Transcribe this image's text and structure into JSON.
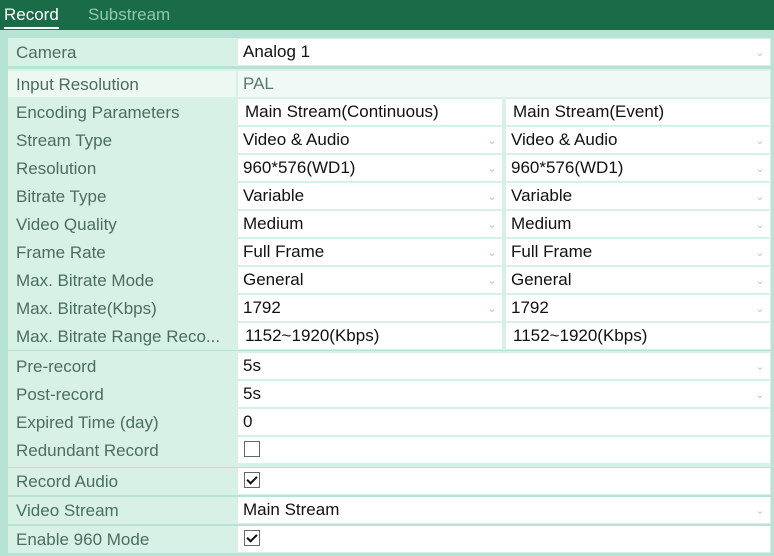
{
  "tabs": [
    {
      "label": "Record",
      "active": true
    },
    {
      "label": "Substream",
      "active": false
    }
  ],
  "camera": {
    "label": "Camera",
    "value": "Analog 1"
  },
  "input_resolution": {
    "label": "Input Resolution",
    "value": "PAL"
  },
  "encoding": {
    "label": "Encoding Parameters",
    "col_main": "Main Stream(Continuous)",
    "col_event": "Main Stream(Event)",
    "rows": [
      {
        "label": "Stream Type",
        "main": "Video & Audio",
        "event": "Video & Audio"
      },
      {
        "label": "Resolution",
        "main": "960*576(WD1)",
        "event": "960*576(WD1)"
      },
      {
        "label": "Bitrate Type",
        "main": "Variable",
        "event": "Variable"
      },
      {
        "label": "Video Quality",
        "main": "Medium",
        "event": "Medium"
      },
      {
        "label": "Frame Rate",
        "main": "Full Frame",
        "event": "Full Frame"
      },
      {
        "label": "Max. Bitrate Mode",
        "main": "General",
        "event": "General"
      },
      {
        "label": "Max. Bitrate(Kbps)",
        "main": "1792",
        "event": "1792"
      }
    ],
    "range_label": "Max. Bitrate Range Reco...",
    "range_main": "1152~1920(Kbps)",
    "range_event": "1152~1920(Kbps)"
  },
  "pre_record": {
    "label": "Pre-record",
    "value": "5s"
  },
  "post_record": {
    "label": "Post-record",
    "value": "5s"
  },
  "expired_time": {
    "label": "Expired Time (day)",
    "value": "0"
  },
  "redundant_record": {
    "label": "Redundant Record",
    "checked": false
  },
  "record_audio": {
    "label": "Record Audio",
    "checked": true
  },
  "video_stream": {
    "label": "Video Stream",
    "value": "Main Stream"
  },
  "enable_960": {
    "label": "Enable 960 Mode",
    "checked": true
  },
  "icons": {
    "dropdown": "chevron-down-icon",
    "check": "checkmark-icon"
  },
  "colors": {
    "header": "#1a6b48",
    "background": "#b6e3d4",
    "label_bg": "#d8f1e7",
    "label_text": "#4b6e5e"
  }
}
